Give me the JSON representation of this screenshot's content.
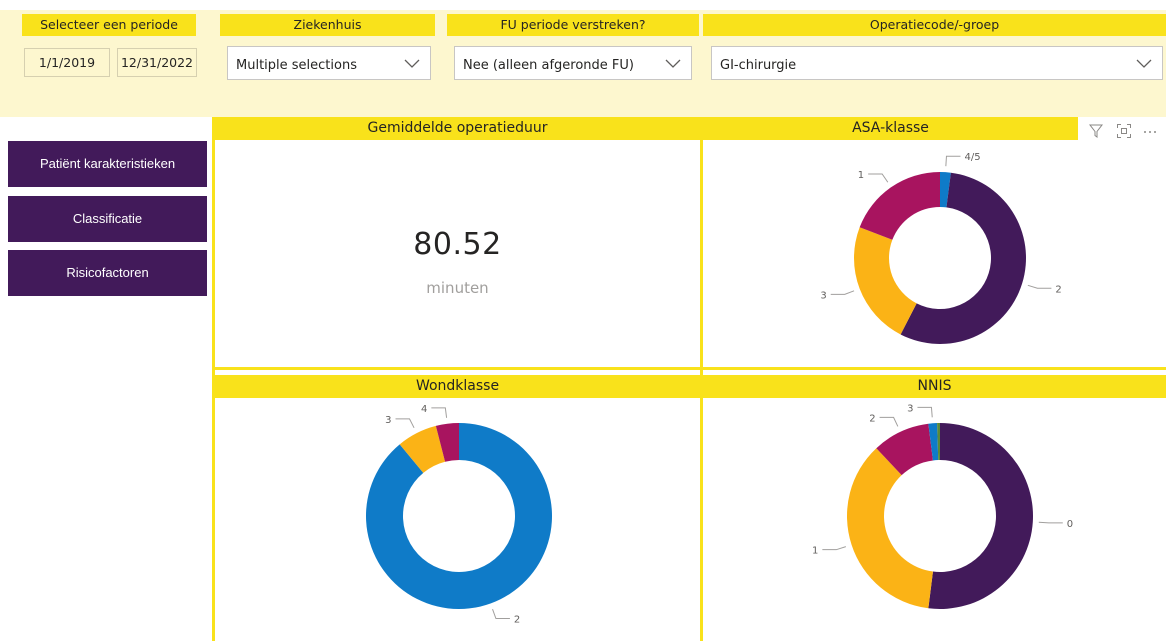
{
  "filters": {
    "period": {
      "title": "Selecteer een periode",
      "start": "1/1/2019",
      "end": "12/31/2022"
    },
    "hospital": {
      "title": "Ziekenhuis",
      "value": "Multiple selections"
    },
    "fu": {
      "title": "FU periode verstreken?",
      "value": "Nee (alleen afgeronde FU)"
    },
    "operation": {
      "title": "Operatiecode/-groep",
      "value": "GI-chirurgie"
    }
  },
  "nav": [
    {
      "label": "Patiënt karakteristieken"
    },
    {
      "label": "Classificatie"
    },
    {
      "label": "Risicofactoren"
    }
  ],
  "kpi": {
    "title": "Gemiddelde operatieduur",
    "value": "80.52",
    "unit": "minuten"
  },
  "visual_toolbar": {
    "icons": [
      "filter-icon",
      "focus-mode-icon",
      "more-options-icon"
    ]
  },
  "colors": {
    "purple": "#421a5a",
    "yellow": "#f9e21b",
    "orange": "#fbb316",
    "magenta": "#a8145f",
    "blue": "#0f7bc8",
    "green": "#5b8a3a"
  },
  "chart_data": [
    {
      "type": "pie",
      "title": "ASA-klasse",
      "donut": true,
      "slices": [
        {
          "label": "4/5",
          "value": 2,
          "color": "#0f7bc8"
        },
        {
          "label": "2",
          "value": 55,
          "color": "#421a5a"
        },
        {
          "label": "3",
          "value": 23,
          "color": "#fbb316"
        },
        {
          "label": "1",
          "value": 19,
          "color": "#a8145f"
        }
      ]
    },
    {
      "type": "pie",
      "title": "Wondklasse",
      "donut": true,
      "slices": [
        {
          "label": "2",
          "value": 89,
          "color": "#0f7bc8"
        },
        {
          "label": "3",
          "value": 7,
          "color": "#fbb316"
        },
        {
          "label": "4",
          "value": 4,
          "color": "#a8145f"
        }
      ]
    },
    {
      "type": "pie",
      "title": "NNIS",
      "donut": true,
      "slices": [
        {
          "label": "0",
          "value": 52,
          "color": "#421a5a"
        },
        {
          "label": "1",
          "value": 36,
          "color": "#fbb316"
        },
        {
          "label": "2",
          "value": 10,
          "color": "#a8145f"
        },
        {
          "label": "3",
          "value": 1.5,
          "color": "#0f7bc8"
        },
        {
          "label": "",
          "value": 0.5,
          "color": "#5b8a3a"
        }
      ]
    }
  ]
}
